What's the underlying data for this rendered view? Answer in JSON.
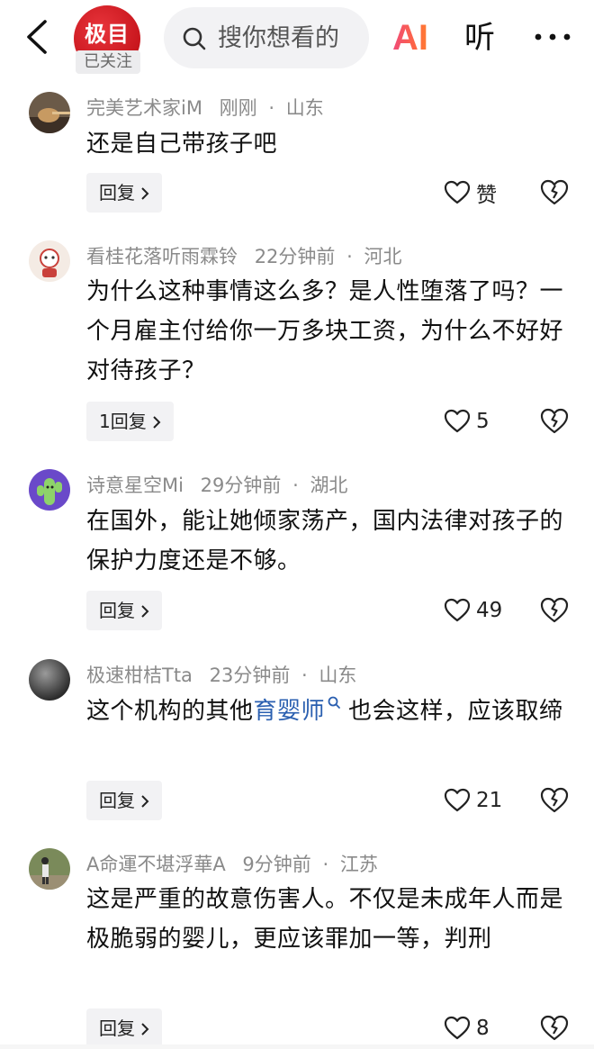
{
  "header": {
    "brand_avatar_text": "极目",
    "follow_status": "已关注",
    "search_placeholder": "搜你想看的",
    "ai_label": "AI",
    "listen_label": "听"
  },
  "comments": [
    {
      "username": "完美艺术家iM",
      "time": "刚刚",
      "location": "山东",
      "text": "还是自己带孩子吧",
      "reply_label": "回复",
      "likes": "赞"
    },
    {
      "username": "看桂花落听雨霖铃",
      "time": "22分钟前",
      "location": "河北",
      "text": "为什么这种事情这么多？是人性堕落了吗？一个月雇主付给你一万多块工资，为什么不好好对待孩子？",
      "reply_label": "1回复",
      "likes": "5"
    },
    {
      "username": "诗意星空Mi",
      "time": "29分钟前",
      "location": "湖北",
      "text": "在国外，能让她倾家荡产，国内法律对孩子的保护力度还是不够。",
      "reply_label": "回复",
      "likes": "49"
    },
    {
      "username": "极速柑桔Tta",
      "time": "23分钟前",
      "location": "山东",
      "text_before": "这个机构的其他",
      "text_link": "育婴师",
      "text_after": "也会这样，应该取缔",
      "reply_label": "回复",
      "likes": "21"
    },
    {
      "username": "A命運不堪浮華A",
      "time": "9分钟前",
      "location": "江苏",
      "text": "这是严重的故意伤害人。不仅是未成年人而是极脆弱的婴儿，更应该罪加一等，判刑",
      "reply_label": "回复",
      "likes": "8"
    }
  ],
  "meta_separator": "·",
  "icons": {
    "back": "chevron-left-icon",
    "search": "search-icon",
    "more": "more-dots-icon",
    "like": "heart-icon",
    "dislike": "broken-heart-icon",
    "reply_arrow": "chevron-right-icon"
  },
  "colors": {
    "brand_red": "#c8161d",
    "link_blue": "#2a5fb0",
    "meta_gray": "#8a8a8a",
    "button_bg": "#f2f2f4"
  }
}
